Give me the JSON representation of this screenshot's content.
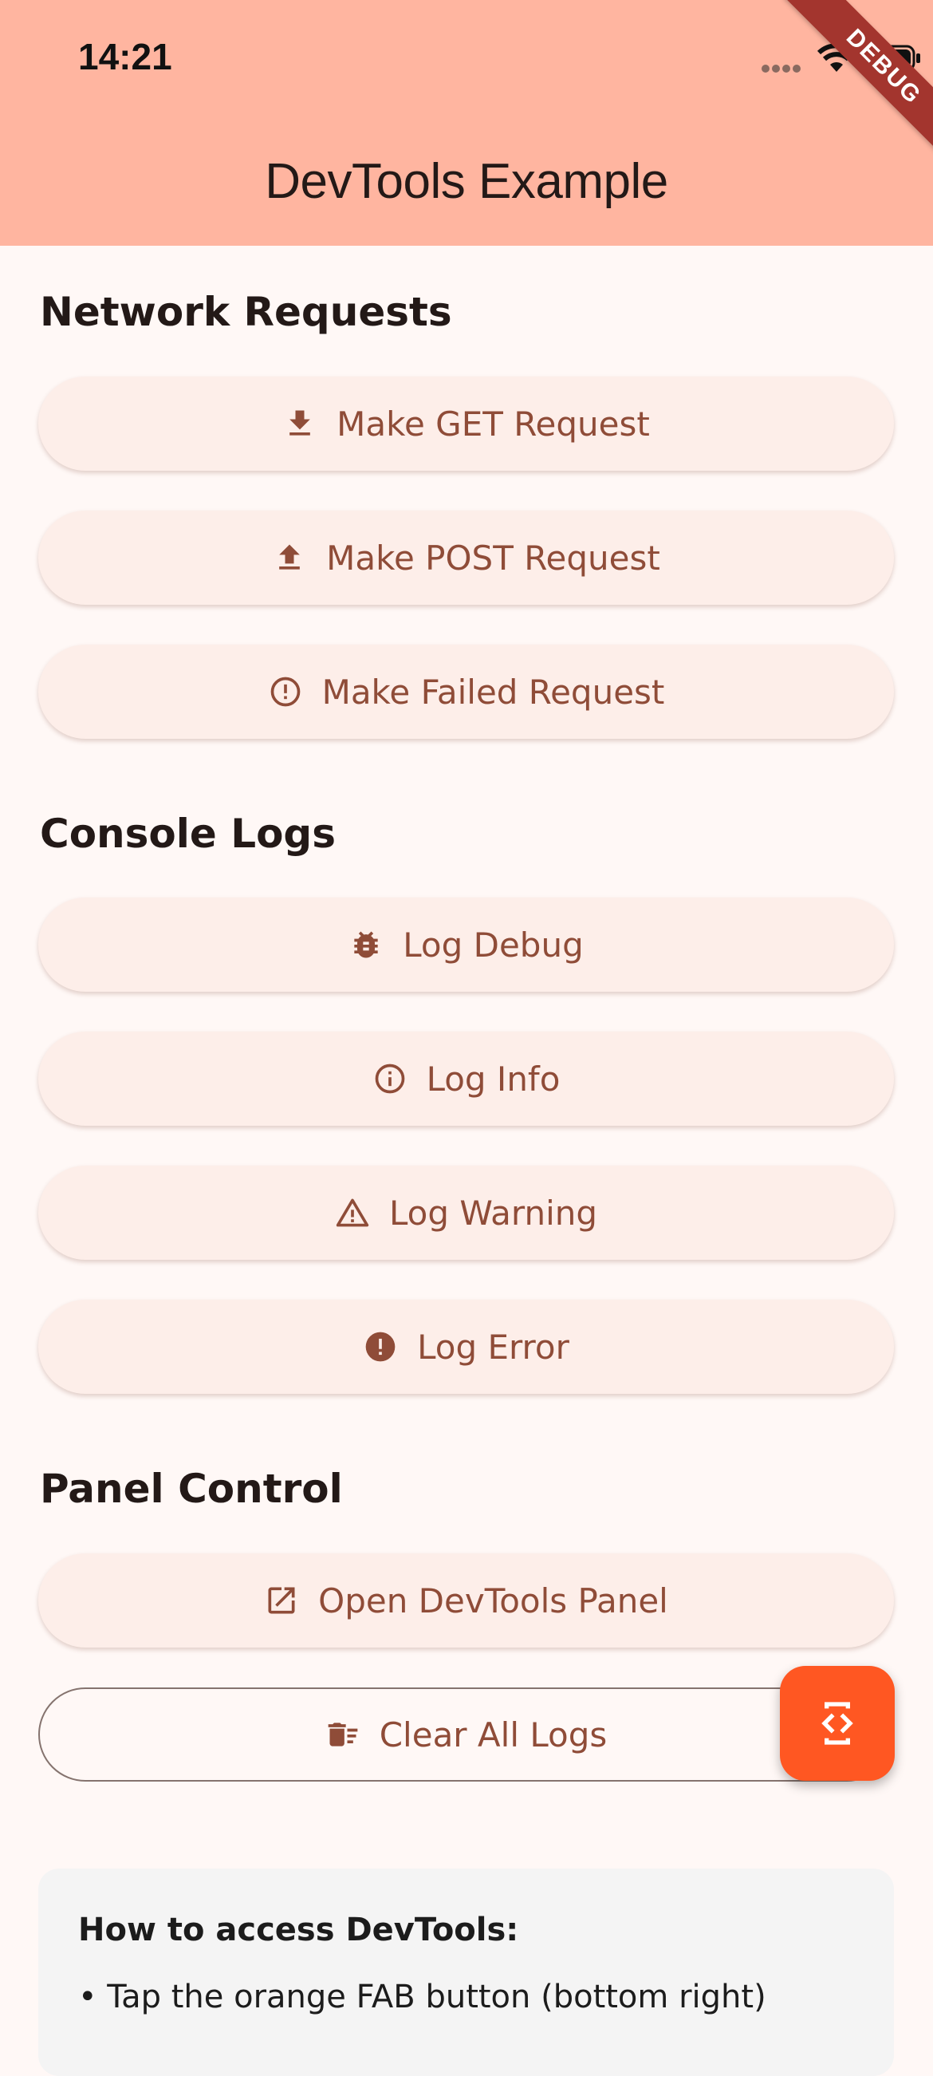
{
  "status_bar": {
    "time": "14:21"
  },
  "app_bar": {
    "title": "DevTools Example",
    "debug_banner": "DEBUG"
  },
  "colors": {
    "primary": "#8f4c38",
    "app_bar": "#ffb5a0",
    "fab": "#ff5722",
    "background": "#fff8f6"
  },
  "sections": {
    "network": {
      "title": "Network Requests",
      "get_label": "Make GET Request",
      "post_label": "Make POST Request",
      "failed_label": "Make Failed Request"
    },
    "console": {
      "title": "Console Logs",
      "debug_label": "Log Debug",
      "info_label": "Log Info",
      "warning_label": "Log Warning",
      "error_label": "Log Error"
    },
    "panel": {
      "title": "Panel Control",
      "open_label": "Open DevTools Panel",
      "clear_label": "Clear All Logs"
    }
  },
  "info": {
    "title": "How to access DevTools:",
    "line1": "• Tap the orange FAB button (bottom right)"
  },
  "icons": {
    "get": "download-icon",
    "post": "upload-icon",
    "failed": "error-outline-icon",
    "debug": "bug-icon",
    "info": "info-outline-icon",
    "warning": "warning-outline-icon",
    "error": "error-filled-icon",
    "open": "open-in-new-icon",
    "clear": "delete-sweep-icon",
    "fab": "developer-mode-icon"
  }
}
